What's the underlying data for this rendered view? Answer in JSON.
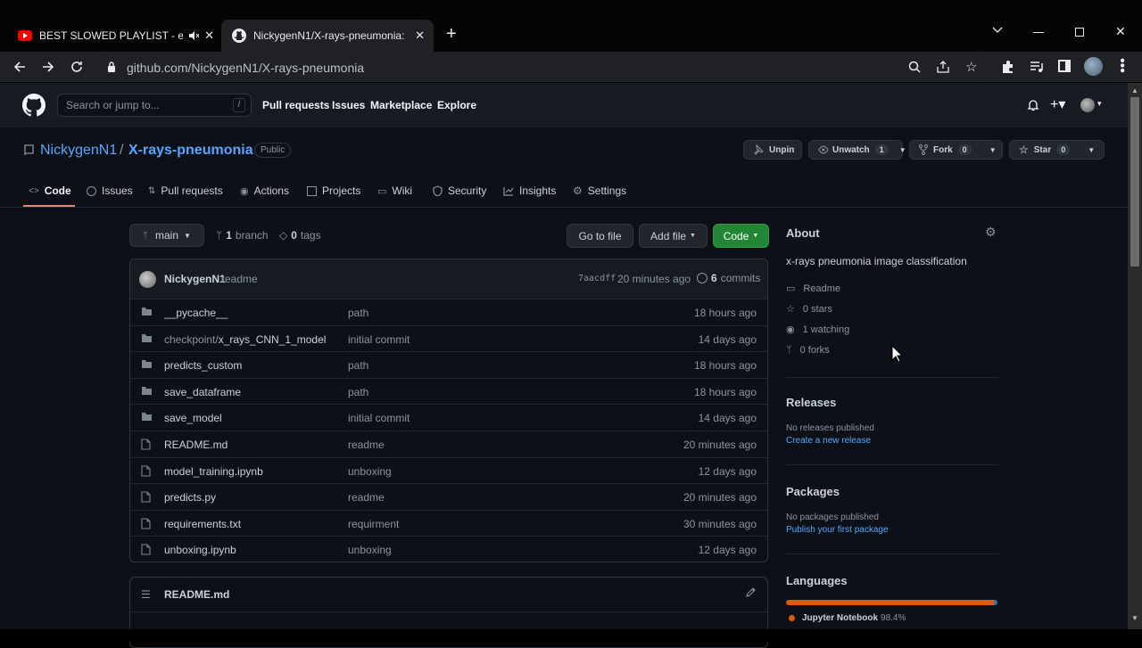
{
  "browser": {
    "tabs": [
      {
        "title": "BEST SLOWED PLAYLIST - ev",
        "icon": "youtube-icon"
      },
      {
        "title": "NickygenN1/X-rays-pneumonia:",
        "icon": "github-icon"
      }
    ],
    "url": "github.com/NickygenN1/X-rays-pneumonia"
  },
  "header": {
    "search_placeholder": "Search or jump to...",
    "search_shortcut": "/",
    "nav": [
      "Pull requests",
      "Issues",
      "Marketplace",
      "Explore"
    ]
  },
  "repo": {
    "owner": "NickygenN1",
    "separator": "/",
    "name": "X-rays-pneumonia",
    "visibility": "Public",
    "unpin": "Unpin",
    "unwatch": "Unwatch",
    "watch_count": "1",
    "fork": "Fork",
    "fork_count": "0",
    "star": "Star",
    "star_count": "0",
    "tabs": [
      "Code",
      "Issues",
      "Pull requests",
      "Actions",
      "Projects",
      "Wiki",
      "Security",
      "Insights",
      "Settings"
    ],
    "active_tab": "Code"
  },
  "toolbar": {
    "branch": "main",
    "branch_count": "1",
    "branch_label": "branch",
    "tag_count": "0",
    "tag_label": "tags",
    "go_to_file": "Go to file",
    "add_file": "Add file",
    "code": "Code"
  },
  "commit": {
    "author": "NickygenN1",
    "message": "readme",
    "sha": "7aacdff",
    "time": "20 minutes ago",
    "count": "6",
    "label": "commits"
  },
  "files": [
    {
      "type": "dir",
      "prefix": "",
      "name": "__pycache__",
      "msg": "path",
      "time": "18 hours ago"
    },
    {
      "type": "dir",
      "prefix": "checkpoint/",
      "name": "x_rays_CNN_1_model",
      "msg": "initial commit",
      "time": "14 days ago"
    },
    {
      "type": "dir",
      "prefix": "",
      "name": "predicts_custom",
      "msg": "path",
      "time": "18 hours ago"
    },
    {
      "type": "dir",
      "prefix": "",
      "name": "save_dataframe",
      "msg": "path",
      "time": "18 hours ago"
    },
    {
      "type": "dir",
      "prefix": "",
      "name": "save_model",
      "msg": "initial commit",
      "time": "14 days ago"
    },
    {
      "type": "file",
      "prefix": "",
      "name": "README.md",
      "msg": "readme",
      "time": "20 minutes ago"
    },
    {
      "type": "file",
      "prefix": "",
      "name": "model_training.ipynb",
      "msg": "unboxing",
      "time": "12 days ago"
    },
    {
      "type": "file",
      "prefix": "",
      "name": "predicts.py",
      "msg": "readme",
      "time": "20 minutes ago"
    },
    {
      "type": "file",
      "prefix": "",
      "name": "requirements.txt",
      "msg": "requirment",
      "time": "30 minutes ago"
    },
    {
      "type": "file",
      "prefix": "",
      "name": "unboxing.ipynb",
      "msg": "unboxing",
      "time": "12 days ago"
    }
  ],
  "readme": {
    "title": "README.md"
  },
  "about": {
    "heading": "About",
    "description": "x-rays pneumonia image classification",
    "readme": "Readme",
    "stars": "0 stars",
    "watching": "1 watching",
    "forks": "0 forks"
  },
  "releases": {
    "heading": "Releases",
    "none": "No releases published",
    "link": "Create a new release"
  },
  "packages": {
    "heading": "Packages",
    "none": "No packages published",
    "link": "Publish your first package"
  },
  "languages": {
    "heading": "Languages",
    "items": [
      {
        "name": "Jupyter Notebook",
        "percent": "98.4%",
        "value": 98.4,
        "color": "#DA5B0B"
      },
      {
        "value": 1.6,
        "color": "#3572A5"
      }
    ]
  },
  "colors": {
    "accent": "#238636",
    "link": "#58a6ff",
    "bg": "#0d1117"
  }
}
